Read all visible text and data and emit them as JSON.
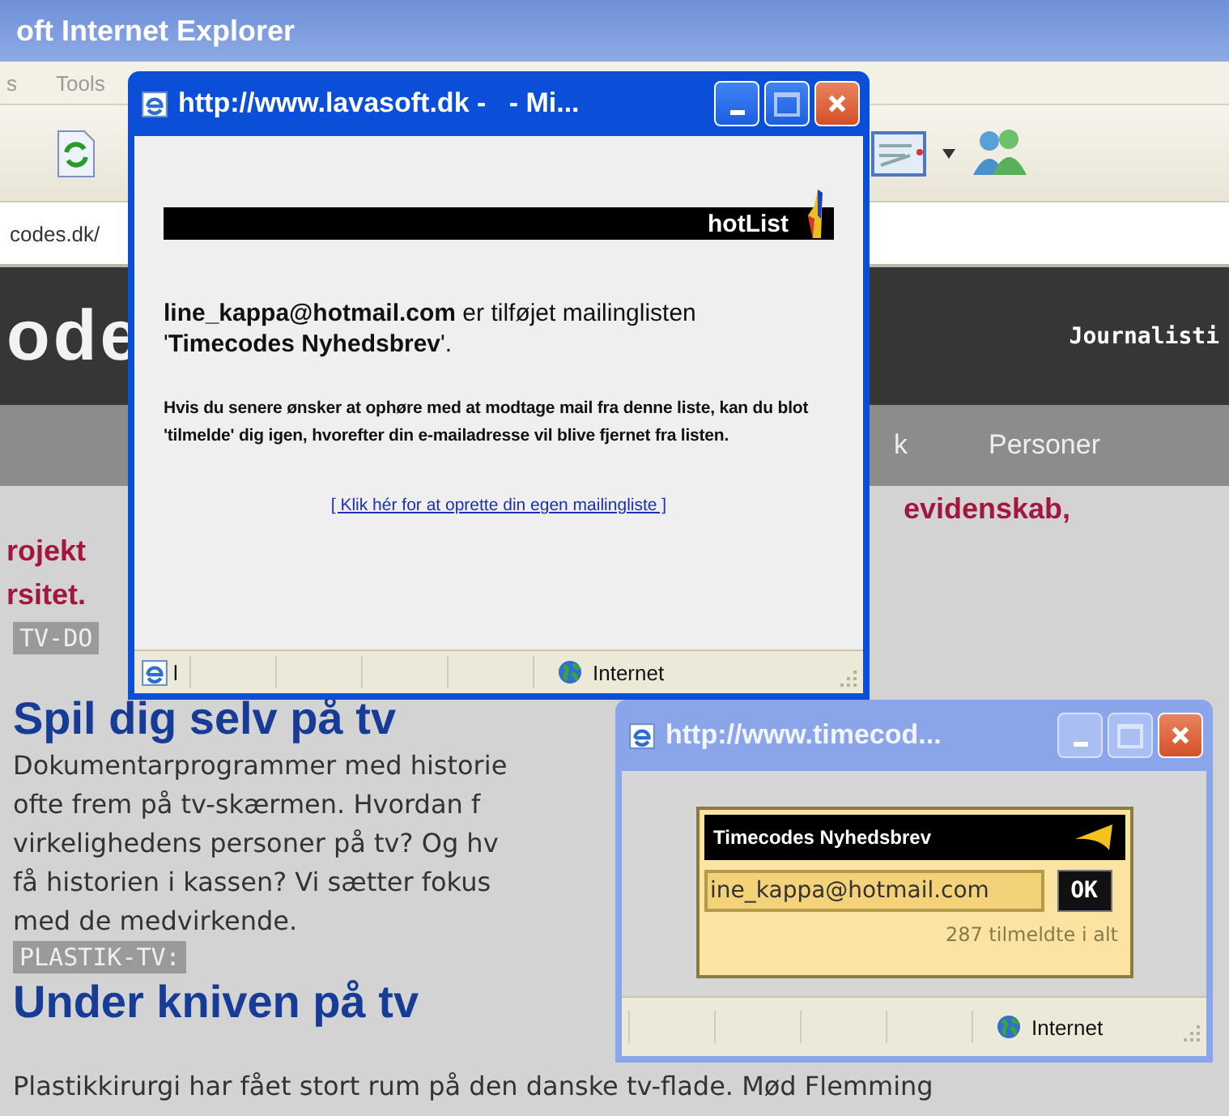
{
  "browser": {
    "title": "oft Internet Explorer",
    "menu": [
      "s",
      "Tools"
    ],
    "address": "codes.dk/",
    "site_logo": "ode",
    "header_link": "Journalisti",
    "nav": [
      "k",
      "Personer"
    ],
    "article": {
      "fragment_right": "evidenskab,",
      "fragments_left": [
        "rojekt",
        "rsitet."
      ],
      "tag": "TV-DO",
      "heading": "Spil dig selv på tv",
      "body_lines": [
        "Dokumentarprogrammer med historie",
        "ofte frem på tv-skærmen. Hvordan f",
        "virkelighedens personer på tv? Og hv",
        "få historien i kassen? Vi sætter fokus",
        "med de medvirkende."
      ],
      "tag_2": "PLASTIK-TV:",
      "heading_2": "Under kniven på tv",
      "body_2": "Plastikkirurgi har fået stort rum på den danske tv-flade. Mød Flemming"
    }
  },
  "popup_hotlist": {
    "title": "http://www.lavasoft.dk -   - Mi...",
    "banner": "hotList",
    "message": "**line_kappa@hotmail.com** er tilføjet mailinglisten '**Timecodes Nyhedsbrev**'.",
    "info": "Hvis du senere ønsker at ophøre med at modtage mail fra denne liste, kan du blot 'tilmelde' dig igen, hvorefter din e-mailadresse vil blive fjernet fra listen.",
    "link": "[ Klik hér for at oprette din egen mailingliste ]",
    "status_text": "l",
    "zone": "Internet"
  },
  "popup_signup": {
    "title": "http://www.timecod...",
    "widget_title": "Timecodes Nyhedsbrev",
    "email_value": "ine_kappa@hotmail.com",
    "button": "OK",
    "count": "287 tilmeldte i alt",
    "zone": "Internet"
  }
}
